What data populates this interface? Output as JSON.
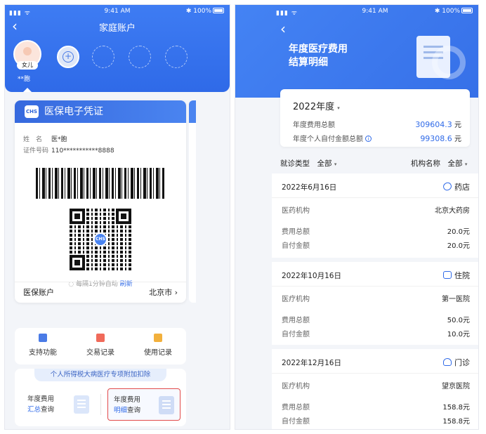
{
  "status_bar": {
    "time": "9:41 AM",
    "battery": "100%",
    "signal": "▮▮▮ ᯤ",
    "bluetooth": "✱"
  },
  "left": {
    "title": "家庭账户",
    "back_icon": "‹",
    "selected_member": {
      "tag": "女儿",
      "name": "**胞"
    },
    "add_icon": "+",
    "card": {
      "logo": "CHS",
      "title": "医保电子凭证",
      "name_label": "姓　名",
      "name_value": "医*胞",
      "id_label": "证件号码",
      "id_value": "110***********8888",
      "qr_logo": "CHS",
      "refresh_text": "每隔1分钟自动",
      "refresh_link": "刷新",
      "refresh_icon": "◌",
      "footer_label": "医保账户",
      "footer_value": "北京市",
      "footer_chevron": "›"
    },
    "functions": [
      {
        "label": "支持功能",
        "color": "#4a7be6"
      },
      {
        "label": "交易记录",
        "color": "#f06a5a"
      },
      {
        "label": "使用记录",
        "color": "#f2b03c"
      }
    ],
    "tax": {
      "title": "个人所得税大病医疗专项附加扣除",
      "item1_line1": "年度费用",
      "item1_blue": "汇总",
      "item1_rest": "查询",
      "item2_line1": "年度费用",
      "item2_blue": "明细",
      "item2_rest": "查询"
    }
  },
  "right": {
    "back_icon": "‹",
    "title_line1": "年度医疗费用",
    "title_line2": "结算明细",
    "summary": {
      "year": "2022年度",
      "year_caret": "▾",
      "total_label": "年度费用总额",
      "total_value": "309604.3",
      "total_unit": "元",
      "self_label": "年度个人自付金额总额",
      "info_icon": "i",
      "self_value": "99308.6",
      "self_unit": "元"
    },
    "filters": {
      "type_label": "就诊类型",
      "type_value": "全部",
      "org_label": "机构名称",
      "org_value": "全部",
      "caret": "▾"
    },
    "records": [
      {
        "date": "2022年6月16日",
        "type": "药店",
        "org_label": "医药机构",
        "org": "北京大药房",
        "total_label": "费用总额",
        "total": "20.0元",
        "self_label": "自付金额",
        "self": "20.0元"
      },
      {
        "date": "2022年10月16日",
        "type": "住院",
        "org_label": "医疗机构",
        "org": "第一医院",
        "total_label": "费用总额",
        "total": "50.0元",
        "self_label": "自付金额",
        "self": "10.0元"
      },
      {
        "date": "2022年12月16日",
        "type": "门诊",
        "org_label": "医疗机构",
        "org": "望京医院",
        "total_label": "费用总额",
        "total": "158.8元",
        "self_label": "自付金额",
        "self": "158.8元"
      }
    ]
  }
}
